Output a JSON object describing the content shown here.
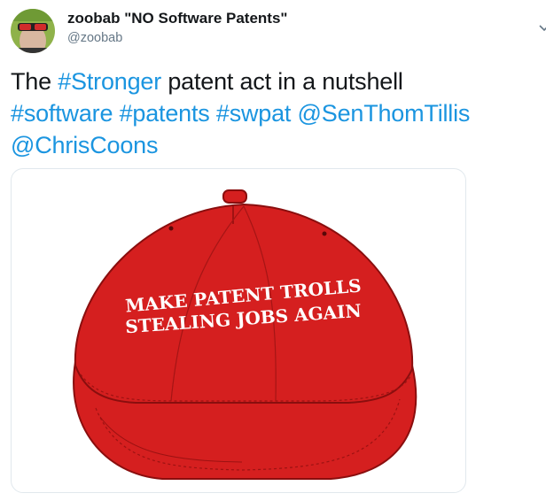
{
  "user": {
    "display_name": "zoobab \"NO Software Patents\"",
    "handle": "@zoobab"
  },
  "tweet": {
    "lead_text": "The ",
    "hashtag_stronger": "#Stronger",
    "middle_text": " patent act in a nutshell",
    "hashtag_software": "#software",
    "hashtag_patents": "#patents",
    "hashtag_swpat": "#swpat",
    "mention_tillis": "@SenThomTillis",
    "mention_coons": "@ChrisCoons"
  },
  "media": {
    "cap_line1": "MAKE PATENT TROLLS",
    "cap_line2": "STEALING JOBS AGAIN",
    "cap_color": "#d51f1f"
  },
  "icons": {
    "avatar": "avatar-image",
    "caret": "chevron-down-icon"
  },
  "colors": {
    "link": "#1b95e0",
    "secondary_text": "#657786",
    "card_border": "#e1e8ed"
  }
}
